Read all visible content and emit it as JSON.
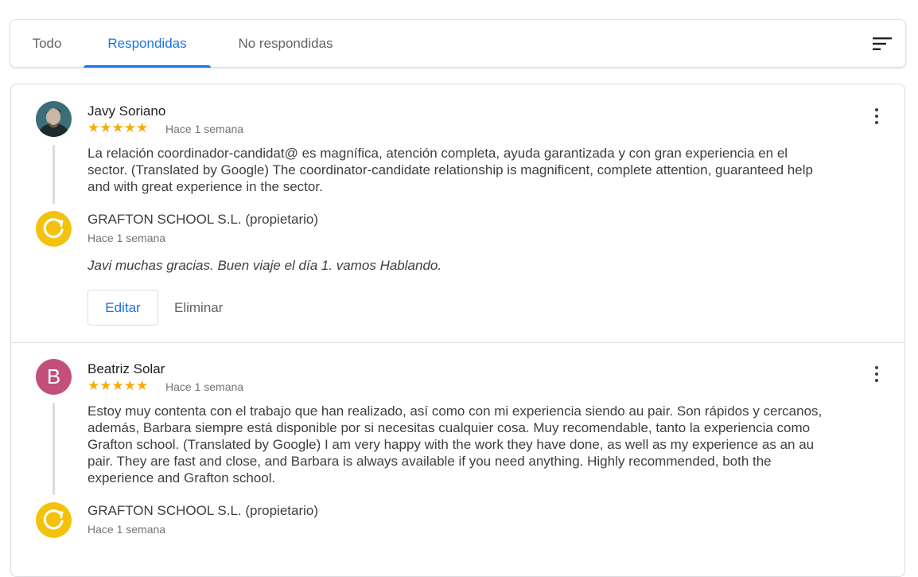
{
  "tabs": [
    {
      "label": "Todo"
    },
    {
      "label": "Respondidas"
    },
    {
      "label": "No respondidas"
    }
  ],
  "active_tab": "Respondidas",
  "icons": {
    "sort": "sort-icon",
    "more": "more-vert-icon",
    "owner_logo": "grafton-logo-icon"
  },
  "colors": {
    "accent": "#1a73e8",
    "star": "#f9ab00",
    "avatar_b": "#c2507a",
    "logo": "#f4c20d"
  },
  "reviews": [
    {
      "reviewer": "Javy Soriano",
      "rating": 5,
      "stars": "★★★★★",
      "date": "Hace 1 semana",
      "text": "La relación coordinador-candidat@ es magnífica, atención completa, ayuda garantizada y con gran experiencia en el sector. (Translated by Google) The coordinator-candidate relationship is magnificent, complete attention, guaranteed help and with great experience in the sector.",
      "reply": {
        "owner": "GRAFTON SCHOOL S.L. (propietario)",
        "date": "Hace 1 semana",
        "text": "Javi muchas gracias. Buen viaje el día 1. vamos Hablando."
      },
      "actions": {
        "edit": "Editar",
        "delete": "Eliminar"
      }
    },
    {
      "reviewer": "Beatriz Solar",
      "avatar_letter": "B",
      "rating": 5,
      "stars": "★★★★★",
      "date": "Hace 1 semana",
      "text": "Estoy muy contenta con el trabajo que han realizado, así como con mi experiencia siendo au pair. Son rápidos y cercanos, además, Barbara siempre está disponible por si necesitas cualquier cosa. Muy recomendable, tanto la experiencia como Grafton school. (Translated by Google) I am very happy with the work they have done, as well as my experience as an au pair. They are fast and close, and Barbara is always available if you need anything. Highly recommended, both the experience and Grafton school.",
      "reply": {
        "owner": "GRAFTON SCHOOL S.L. (propietario)",
        "date": "Hace 1 semana"
      }
    }
  ]
}
